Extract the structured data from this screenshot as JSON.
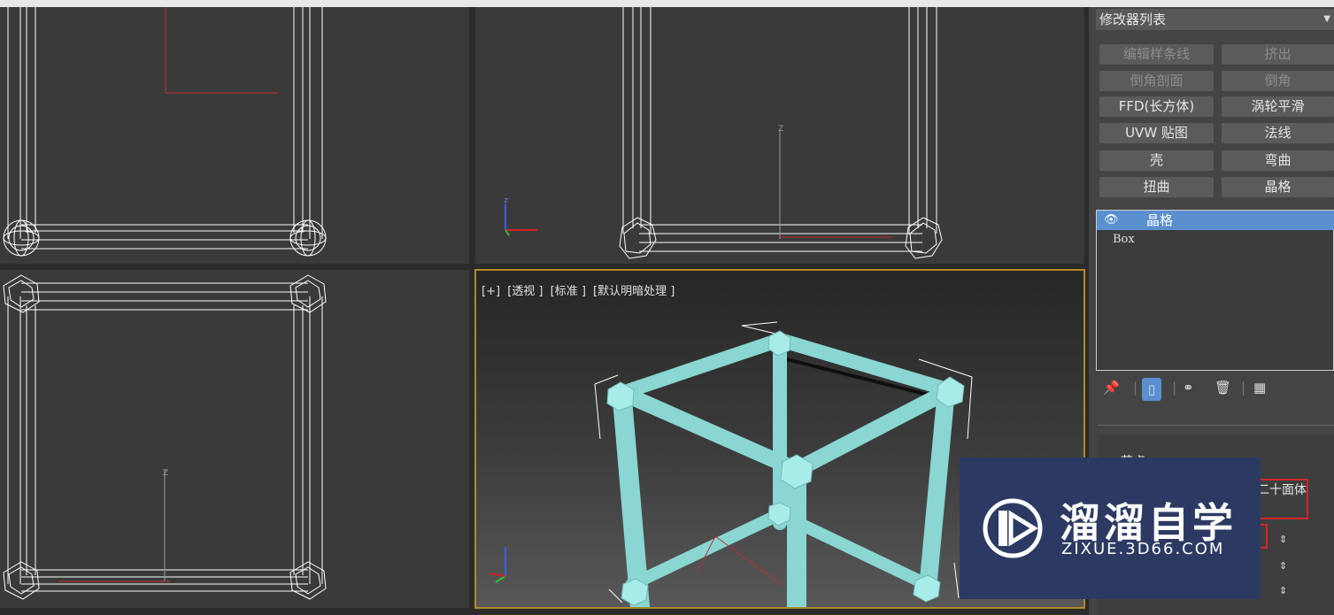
{
  "viewport": {
    "perspective_label": [
      "[+]",
      "[透视 ]",
      "[标准 ]",
      "[默认明暗处理 ]"
    ]
  },
  "panel": {
    "modifier_list": "修改器列表",
    "buttons": [
      {
        "label": "编辑样条线",
        "enabled": false
      },
      {
        "label": "挤出",
        "enabled": false
      },
      {
        "label": "倒角剖面",
        "enabled": false
      },
      {
        "label": "倒角",
        "enabled": false
      },
      {
        "label": "FFD(长方体)",
        "enabled": true
      },
      {
        "label": "涡轮平滑",
        "enabled": true
      },
      {
        "label": "UVW 贴图",
        "enabled": true
      },
      {
        "label": "法线",
        "enabled": true
      },
      {
        "label": "壳",
        "enabled": true
      },
      {
        "label": "弯曲",
        "enabled": true
      },
      {
        "label": "扭曲",
        "enabled": true
      },
      {
        "label": "晶格",
        "enabled": true
      }
    ],
    "stack": {
      "selected": "晶格",
      "base": "Box"
    },
    "rollout": {
      "group_label": "节点",
      "geodesic_type": "二十面体"
    }
  },
  "watermark": {
    "name": "溜溜自学",
    "url": "ZIXUE.3D66.COM"
  },
  "colors": {
    "accent_blue": "#5a8fd0",
    "lattice": "#8ed8d6",
    "active_border": "#b28a24",
    "watermark_bg": "#2c3a63"
  }
}
